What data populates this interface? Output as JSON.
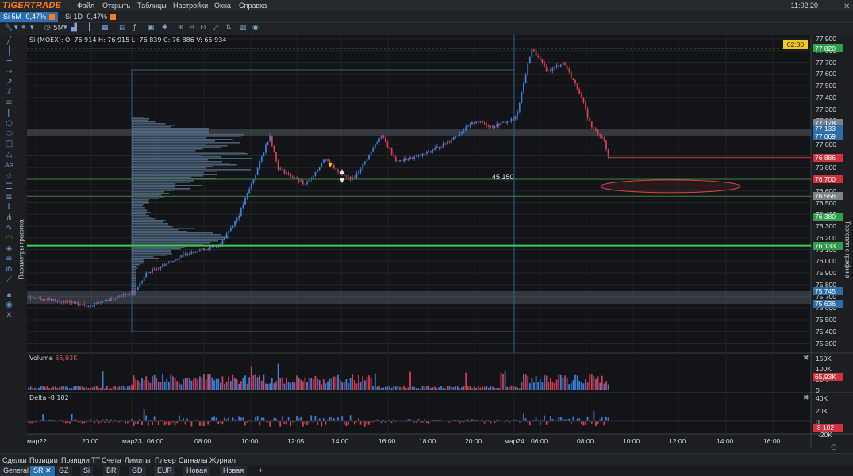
{
  "menubar": {
    "logo": "TIGERTRADE",
    "items": [
      "Файл",
      "Открыть",
      "Таблицы",
      "Настройки",
      "Окна",
      "Справка"
    ],
    "clock": "11:02:20"
  },
  "chart_tabs": [
    {
      "label": "Si 5M -0,47%",
      "active": true,
      "color": "#ff7a1a"
    },
    {
      "label": "Si 1D -0,47%",
      "active": false,
      "color": "#ff7a1a"
    }
  ],
  "toolbar": {
    "timeframe": "5M"
  },
  "left_panel_label": "Параметры графика",
  "right_panel_label": "Торговля с графика",
  "chart": {
    "info": "Si (MOEX): O: 76 914  H: 76 915  L: 76 839  C: 76 886  V: 65 934",
    "timer": "02:30",
    "cluster_label": "45 150",
    "price_ticks": [
      "77 900",
      "77 800",
      "77 700",
      "77 600",
      "77 500",
      "77 400",
      "77 300",
      "77 200",
      "77 100",
      "77 000",
      "76 900",
      "76 800",
      "76 700",
      "76 600",
      "76 500",
      "76 400",
      "76 300",
      "76 200",
      "76 100",
      "76 000",
      "75 900",
      "75 800",
      "75 700",
      "75 600",
      "75 500",
      "75 400",
      "75 300"
    ],
    "price_tags": [
      {
        "value": "77 820",
        "color": "#2e9e4a"
      },
      {
        "value": "77 178",
        "color": "#7a828c"
      },
      {
        "value": "77 133",
        "color": "#2e6ea6"
      },
      {
        "value": "77 069",
        "color": "#2e6ea6"
      },
      {
        "value": "76 886",
        "color": "#d2303c"
      },
      {
        "value": "76 700",
        "color": "#d2303c"
      },
      {
        "value": "76 556",
        "color": "#7a828c"
      },
      {
        "value": "76 380",
        "color": "#2e9e4a"
      },
      {
        "value": "76 133",
        "color": "#2e9e4a"
      },
      {
        "value": "75 745",
        "color": "#2e6ea6"
      },
      {
        "value": "75 636",
        "color": "#2e6ea6"
      }
    ]
  },
  "volume_pane": {
    "title": "Volume",
    "value": "65,93K",
    "ticks": [
      "150K",
      "100K",
      "50K",
      "0"
    ],
    "tag": "65,93K"
  },
  "delta_pane": {
    "title": "Delta",
    "value": "-8 102",
    "ticks": [
      "40K",
      "20K",
      "0",
      "-20K"
    ],
    "tag": "-8 102"
  },
  "time_axis": [
    "мар22",
    "20:00",
    "мар23",
    "06:00",
    "08:00",
    "10:00",
    "12:05",
    "14:00",
    "16:00",
    "18:00",
    "20:00",
    "мар24",
    "06:00",
    "08:00",
    "10:00",
    "12:00",
    "14:00",
    "16:00"
  ],
  "bottom_tabs": [
    "Сделки",
    "Позиции",
    "Позиции ТТ",
    "Счета",
    "Лимиты",
    "Плеер",
    "Сигналы",
    "Журнал"
  ],
  "workspace_tabs": [
    "General",
    "SR",
    "GZ",
    "Si",
    "BR",
    "GD",
    "EUR",
    "Новая",
    "Новая",
    "+"
  ],
  "colors": {
    "up": "#3b7dd8",
    "down": "#d63d4f",
    "accent": "#2b6fb0",
    "brand": "#ff7a1a"
  }
}
